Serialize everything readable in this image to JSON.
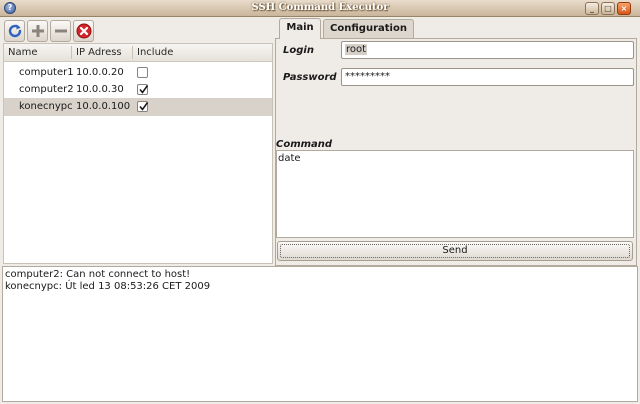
{
  "window": {
    "title": "SSH Command Executor"
  },
  "toolbar": {
    "refresh_icon": "refresh-icon",
    "add_icon": "plus-icon",
    "remove_icon": "minus-icon",
    "stop_icon": "stop-icon"
  },
  "hosts": {
    "columns": {
      "name": "Name",
      "ip": "IP Adress",
      "include": "Include"
    },
    "rows": [
      {
        "name": "computer1",
        "ip": "10.0.0.20",
        "include": false,
        "selected": false
      },
      {
        "name": "computer2",
        "ip": "10.0.0.30",
        "include": true,
        "selected": false
      },
      {
        "name": "konecnypc",
        "ip": "10.0.0.100",
        "include": true,
        "selected": true
      }
    ]
  },
  "tabs": {
    "main": "Main",
    "configuration": "Configuration",
    "active": "main"
  },
  "main": {
    "login_label": "Login",
    "login_value": "root",
    "password_label": "Password",
    "password_value": "*********",
    "command_label": "Command",
    "command_value": "date",
    "send_label": "Send"
  },
  "log": {
    "lines": [
      "computer2: Can not connect to host!",
      "konecnypc: Út led 13 08:53:26 CET 2009"
    ]
  },
  "colors": {
    "selection": "#d8d2ca",
    "close_button": "#d5561a",
    "titlebar": "#c9b59a"
  }
}
